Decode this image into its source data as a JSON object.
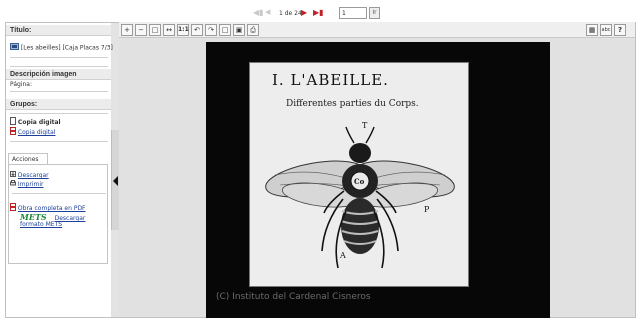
{
  "pager": {
    "first_icon": "first-page-icon",
    "prev_icon": "previous-page-icon",
    "page_info": "1 de 24",
    "next_icon": "next-page-icon",
    "last_icon": "last-page-icon",
    "page_value": "1",
    "go_label": "Ir"
  },
  "sidebar": {
    "titulo_heading": "Título:",
    "titulo_value": "[Les abeilles] [Caja Placas 7/3]",
    "descripcion_heading": "Descripción imagen",
    "pagina_label": "Página:",
    "grupos_heading": "Grupos:",
    "copia_bold": "Copia digital",
    "copia_link": "Copia digital",
    "acciones_tab": "Acciones",
    "descargar": "Descargar",
    "imprimir": "Imprimir",
    "obra_pdf": "Obra completa en PDF",
    "mets_logo": "METS",
    "descargar_mets_1": "Descargar",
    "descargar_mets_2": "formato METS"
  },
  "toolbar": {
    "buttons": [
      "zoom-in",
      "zoom-out",
      "fit-page",
      "fit-width",
      "actual-size",
      "rotate-left",
      "rotate-right",
      "crop",
      "save",
      "print"
    ],
    "actual_size_label": "1:1",
    "right_buttons": [
      "thumbnails",
      "text-view",
      "help"
    ]
  },
  "image": {
    "title": "I. L'ABEILLE.",
    "subtitle": "Differentes parties du Corps.",
    "label_t": "T",
    "label_co": "Co",
    "label_p": "P",
    "label_a": "A",
    "watermark": "(C) Instituto del Cardenal Cisneros"
  }
}
